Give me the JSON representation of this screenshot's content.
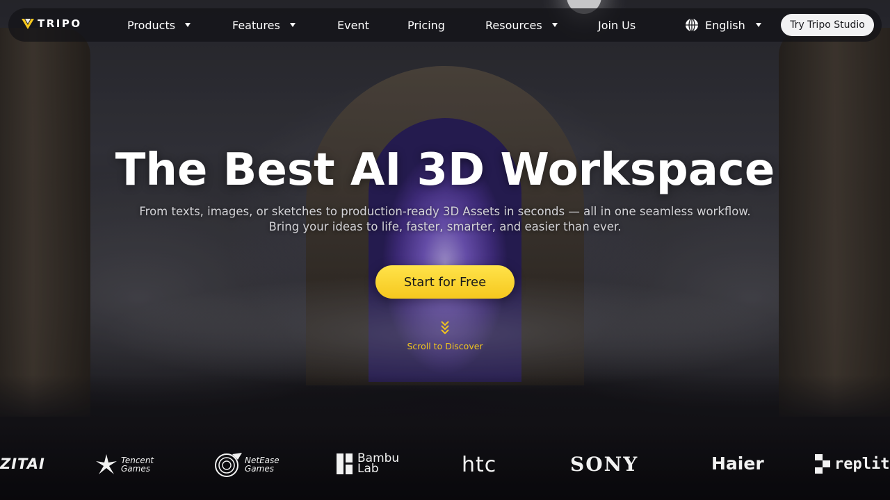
{
  "brand": {
    "name": "TRIPO",
    "accent": "#f6c81e"
  },
  "nav": {
    "items": [
      {
        "label": "Products",
        "has_dropdown": true
      },
      {
        "label": "Features",
        "has_dropdown": true
      },
      {
        "label": "Event",
        "has_dropdown": false
      },
      {
        "label": "Pricing",
        "has_dropdown": false
      },
      {
        "label": "Resources",
        "has_dropdown": true
      },
      {
        "label": "Join Us",
        "has_dropdown": false
      }
    ],
    "language": {
      "label": "English",
      "icon": "globe-icon"
    },
    "cta_label": "Try Tripo Studio"
  },
  "hero": {
    "title": "The Best AI 3D Workspace",
    "subtitle_line1": "From texts, images, or sketches to production-ready 3D Assets in seconds — all in one seamless workflow.",
    "subtitle_line2": "Bring your ideas to life, faster, smarter, and easier than ever.",
    "cta_label": "Start for Free",
    "scroll_label": "Scroll to Discover"
  },
  "partners": {
    "civitai": "ZITAI",
    "tencent": [
      "Tencent",
      "Games"
    ],
    "netease": [
      "NetEase",
      "Games"
    ],
    "bambu": [
      "Bambu",
      "Lab"
    ],
    "htc": "htc",
    "sony": "SONY",
    "haier": "Haier",
    "replit": "replit"
  }
}
